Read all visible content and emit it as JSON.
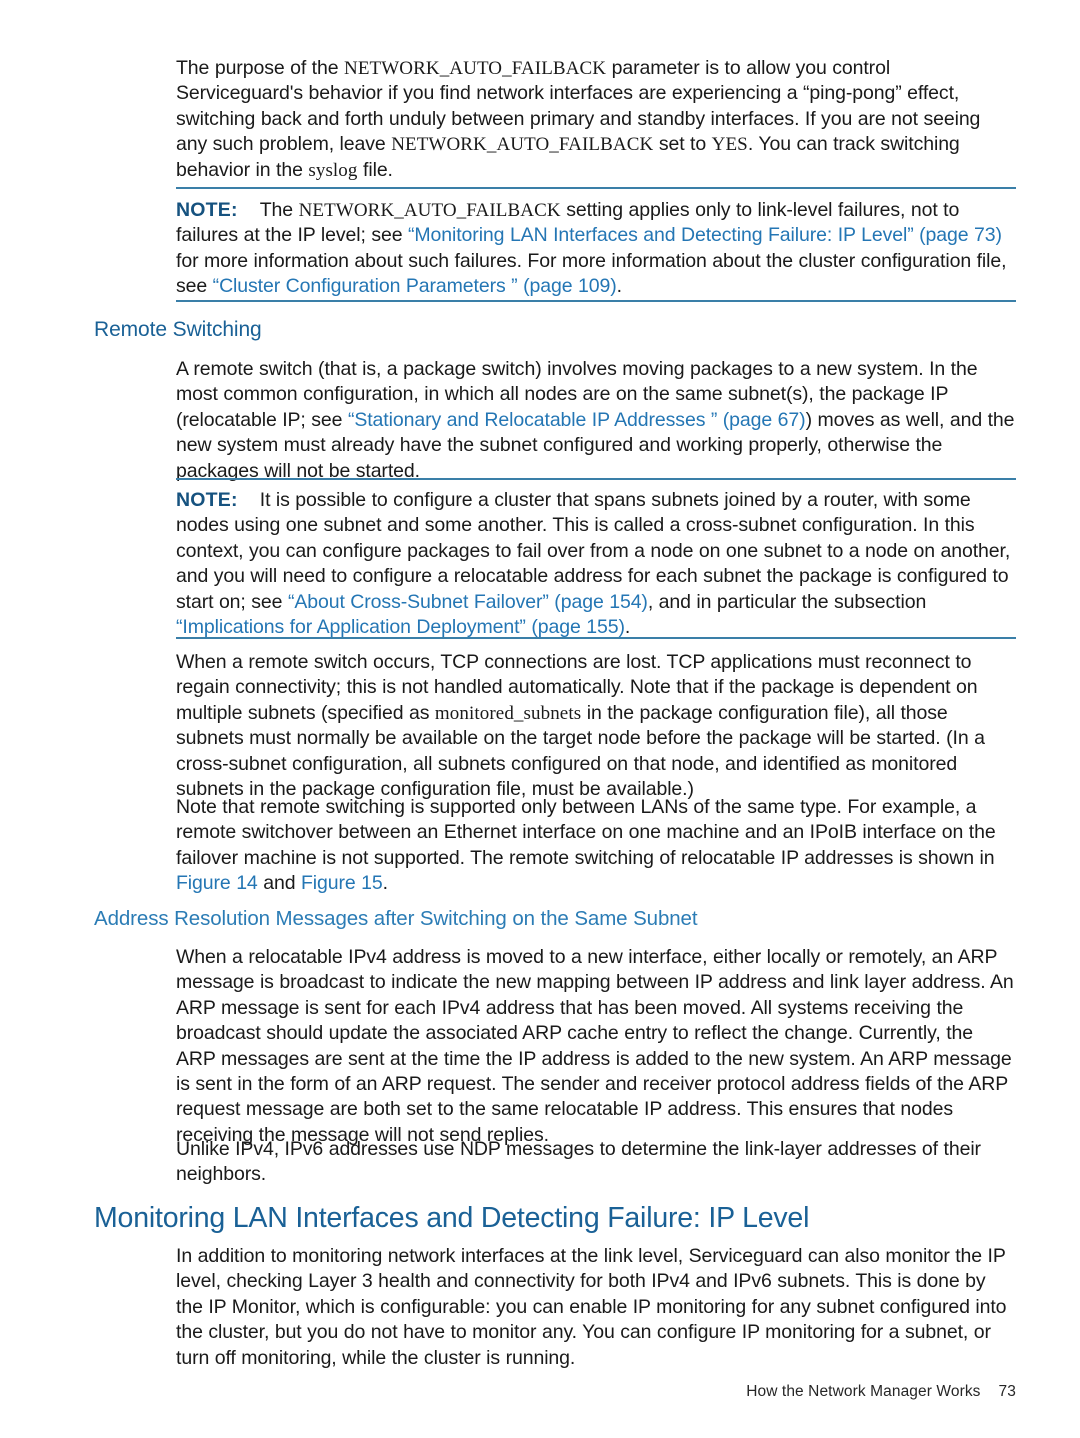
{
  "document": {
    "type": "technical-manual-page",
    "page_number": "73",
    "footer_title": "How the Network Manager Works",
    "colors": {
      "link": "#2476b4",
      "heading": "#1a6196",
      "subheading": "#2b7cb5",
      "note_label": "#16527f",
      "rule": "#3a7fa8",
      "body_text": "#1a1a1a"
    }
  },
  "content": {
    "intro_paragraph": {
      "seg1": "The purpose of the ",
      "code1": "NETWORK_AUTO_FAILBACK",
      "seg2": " parameter is to allow you control Serviceguard's behavior if you find network interfaces are experiencing a “ping-pong” effect, switching back and forth unduly between primary and standby interfaces. If you are not seeing any such problem, leave ",
      "code2": "NETWORK_AUTO_FAILBACK",
      "seg3": " set to ",
      "code3": "YES",
      "seg4": ". You can track switching behavior in the ",
      "code4": "syslog",
      "seg5": " file."
    },
    "note1": {
      "label": "NOTE:",
      "seg1": "The ",
      "code1": "NETWORK_AUTO_FAILBACK",
      "seg2": " setting applies only to link-level failures, not to failures at the IP level; see ",
      "link1": "“Monitoring LAN Interfaces and Detecting Failure: IP Level” (page 73)",
      "seg3": " for more information about such failures. For more information about the cluster configuration file, see ",
      "link2": "“Cluster Configuration Parameters ” (page 109)",
      "seg4": "."
    },
    "remote_switching": {
      "heading": "Remote Switching",
      "paragraph": {
        "seg1": "A remote switch (that is, a package switch) involves moving packages to a new system. In the most common configuration, in which all nodes are on the same subnet(s), the package IP (relocatable IP; see ",
        "link1": "“Stationary and Relocatable IP Addresses ” (page 67)",
        "seg2": ") moves as well, and the new system must already have the subnet configured and working properly, otherwise the packages will not be started."
      }
    },
    "note2": {
      "label": "NOTE:",
      "seg1": "It is possible to configure a cluster that spans subnets joined by a router, with some nodes using one subnet and some another. This is called a cross-subnet configuration. In this context, you can configure packages to fail over from a node on one subnet to a node on another, and you will need to configure a relocatable address for each subnet the package is configured to start on; see ",
      "link1": "“About Cross-Subnet Failover” (page 154)",
      "seg2": ", and in particular the subsection ",
      "link2": "“Implications for Application Deployment” (page 155)",
      "seg3": "."
    },
    "tcp_paragraph": {
      "seg1": "When a remote switch occurs, TCP connections are lost. TCP applications must reconnect to regain connectivity; this is not handled automatically. Note that if the package is dependent on multiple subnets (specified as ",
      "code1": "monitored_subnets",
      "seg2": " in the package configuration file), all those subnets must normally be available on the target node before the package will be started. (In a cross-subnet configuration, all subnets configured on that node, and identified as monitored subnets in the package configuration file, must be available.)"
    },
    "lan_paragraph": {
      "seg1": "Note that remote switching is supported only between LANs of the same type. For example, a remote switchover between an Ethernet interface on one machine and an IPoIB interface on the failover machine is not supported. The remote switching of relocatable IP addresses is shown in ",
      "link1": "Figure 14",
      "seg2": " and ",
      "link2": "Figure 15",
      "seg3": "."
    },
    "address_resolution": {
      "heading": "Address Resolution Messages after Switching on the Same Subnet",
      "paragraph1": "When a relocatable IPv4 address is moved to a new interface, either locally or remotely, an ARP message is broadcast to indicate the new mapping between IP address and link layer address. An ARP message is sent for each IPv4 address that has been moved. All systems receiving the broadcast should update the associated ARP cache entry to reflect the change. Currently, the ARP messages are sent at the time the IP address is added to the new system. An ARP message is sent in the form of an ARP request. The sender and receiver protocol address fields of the ARP request message are both set to the same relocatable IP address. This ensures that nodes receiving the message will not send replies.",
      "paragraph2": "Unlike IPv4, IPv6 addresses use NDP messages to determine the link-layer addresses of their neighbors."
    },
    "monitoring_section": {
      "heading": "Monitoring LAN Interfaces and Detecting Failure: IP Level",
      "paragraph": "In addition to monitoring network interfaces at the link level, Serviceguard can also monitor the IP level, checking Layer 3 health and connectivity for both IPv4 and IPv6 subnets. This is done by the IP Monitor, which is configurable: you can enable IP monitoring for any subnet configured into the cluster, but you do not have to monitor any. You can configure IP monitoring for a subnet, or turn off monitoring, while the cluster is running."
    }
  }
}
